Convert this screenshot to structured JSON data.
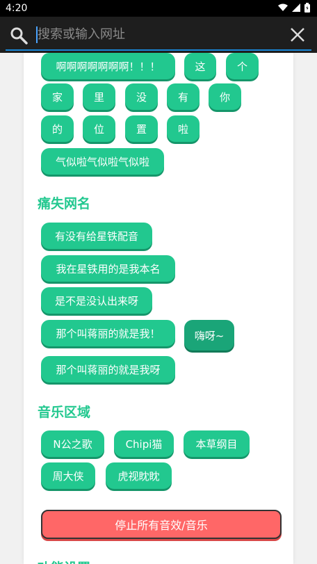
{
  "status": {
    "time": "4:20"
  },
  "search": {
    "placeholder": "搜索或输入网址"
  },
  "group1": {
    "buttons": [
      "啊啊啊啊啊啊啊！！！",
      "这",
      "个",
      "家",
      "里",
      "没",
      "有",
      "你",
      "的",
      "位",
      "置",
      "啦",
      "气似啦气似啦气似啦"
    ]
  },
  "section2": {
    "title": "痛失网名",
    "buttons": [
      "有没有给星铁配音",
      "我在星铁用的是我本名",
      "是不是没认出来呀",
      "那个叫蒋丽的就是我！",
      "嗨呀~",
      "那个叫蒋丽的就是我呀"
    ]
  },
  "section3": {
    "title": "音乐区域",
    "buttons": [
      "N公之歌",
      "Chipi猫",
      "本草纲目",
      "周大侠",
      "虎视眈眈"
    ],
    "stop_label": "停止所有音效/音乐"
  },
  "section4": {
    "title": "功能设置"
  },
  "colors": {
    "accent": "#22c88f",
    "stop": "#ff6767"
  }
}
